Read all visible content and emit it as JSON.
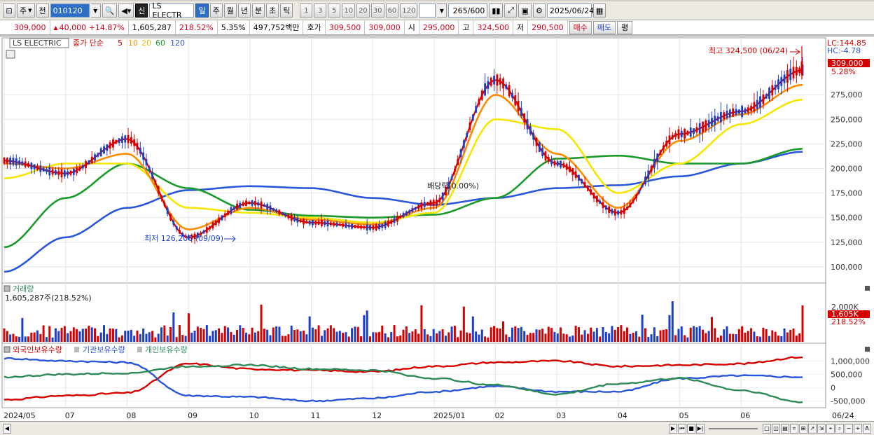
{
  "toolbar": {
    "period_ju": "주",
    "jeon": "전",
    "stock_code": "010120",
    "sin": "신",
    "stock_name": "LS ELECTR",
    "periods": [
      "일",
      "주",
      "월",
      "년",
      "분",
      "초",
      "틱"
    ],
    "active_period": "일",
    "minute_options": [
      "1",
      "3",
      "5",
      "10",
      "20",
      "30",
      "60",
      "120"
    ],
    "count": "265",
    "count_total": "/600",
    "date": "2025/06/24"
  },
  "quote": {
    "price": "309,000",
    "change": "40,000",
    "change_pct": "+14.87%",
    "volume": "1,605,287",
    "volume_ratio": "218.52%",
    "turnover": "5.35%",
    "amount": "497,752백만",
    "hoga_label": "호가",
    "ask": "309,500",
    "bid": "309,000",
    "open_label": "시",
    "open": "295,000",
    "high_label": "고",
    "high": "324,500",
    "low_label": "저",
    "low": "290,500",
    "buy_label": "매수",
    "sell_label": "매도",
    "eval_label": "평"
  },
  "price_panel": {
    "stock_label": "LS ELECTRIC",
    "ma_label": "종가 단순",
    "ma_periods": [
      "5",
      "10",
      "20",
      "60",
      "120"
    ],
    "ma_colors": [
      "#d60000",
      "#ff8c00",
      "#f5e600",
      "#1a9a2a",
      "#2a56d9"
    ],
    "lc": "LC:144.85",
    "hc": "HC:-4.78",
    "last_price": "309,000",
    "last_pct": "5.28%",
    "high_annotation": "최고 324,500 (06/24)",
    "low_annotation": "최저 126,200 (09/09)",
    "dividend_annotation": "배당락(0.00%)",
    "y_ticks": [
      "275,000",
      "250,000",
      "225,000",
      "200,000",
      "175,000",
      "150,000",
      "125,000",
      "100,000"
    ]
  },
  "volume_panel": {
    "title": "거래량",
    "value": "1,605,287주(218.52%)",
    "axis_label": "2,000K",
    "last": "1,605K",
    "last_pct": "218.52%"
  },
  "holdings_panel": {
    "series": [
      {
        "name": "외국인보유수량",
        "color": "#d60000"
      },
      {
        "name": "기관보유수량",
        "color": "#2a56d9"
      },
      {
        "name": "개인보유수량",
        "color": "#2e8b57"
      }
    ],
    "y_ticks": [
      "1,000,000",
      "500,000",
      "0",
      "-500,000"
    ]
  },
  "x_axis": {
    "labels": [
      "2024/05",
      "07",
      "08",
      "09",
      "10",
      "11",
      "12",
      "2025/01",
      "02",
      "03",
      "04",
      "05",
      "06"
    ],
    "right_label": "06/24"
  },
  "chart_data": {
    "type": "line",
    "title": "LS ELECTRIC",
    "x": [
      "2024/05",
      "07",
      "08",
      "09",
      "10",
      "11",
      "12",
      "2025/01",
      "02",
      "03",
      "04",
      "05",
      "06",
      "06/24"
    ],
    "series": [
      {
        "name": "5",
        "values": [
          208000,
          195000,
          230000,
          130000,
          165000,
          145000,
          140000,
          165000,
          290000,
          205000,
          155000,
          235000,
          258000,
          300000
        ]
      },
      {
        "name": "10",
        "values": [
          205000,
          200000,
          215000,
          138000,
          160000,
          148000,
          143000,
          160000,
          275000,
          215000,
          160000,
          228000,
          255000,
          285000
        ]
      },
      {
        "name": "20",
        "values": [
          190000,
          205000,
          205000,
          160000,
          155000,
          150000,
          145000,
          155000,
          250000,
          240000,
          175000,
          205000,
          245000,
          270000
        ]
      },
      {
        "name": "60",
        "values": [
          120000,
          170000,
          205000,
          180000,
          158000,
          152000,
          150000,
          153000,
          170000,
          210000,
          213000,
          205000,
          205000,
          220000
        ]
      },
      {
        "name": "120",
        "values": [
          95000,
          130000,
          160000,
          178000,
          182000,
          180000,
          170000,
          163000,
          170000,
          180000,
          183000,
          192000,
          205000,
          217000
        ]
      }
    ],
    "ylim": [
      85000,
      330000
    ],
    "high": 324500,
    "low": 126200
  }
}
